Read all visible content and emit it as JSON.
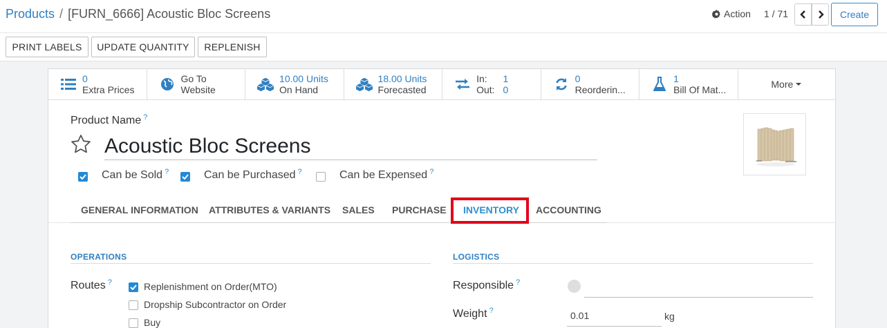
{
  "breadcrumb": {
    "root": "Products",
    "separator": "/",
    "current": "[FURN_6666] Acoustic Bloc Screens"
  },
  "control": {
    "action_label": "Action",
    "pager_value": "1 / 71",
    "create_label": "Create"
  },
  "header_buttons": {
    "print_labels": "PRINT LABELS",
    "update_quantity": "UPDATE QUANTITY",
    "replenish": "REPLENISH"
  },
  "smart_buttons": {
    "extra_prices": {
      "value": "0",
      "label": "Extra Prices",
      "icon": "list-icon"
    },
    "website": {
      "line1": "Go To",
      "line2": "Website",
      "icon": "globe-icon"
    },
    "on_hand": {
      "value": "10.00 Units",
      "label": "On Hand",
      "icon": "cubes-icon"
    },
    "forecasted": {
      "value": "18.00 Units",
      "label": "Forecasted",
      "icon": "cubes-icon"
    },
    "in_out": {
      "in_label": "In:",
      "in_value": "1",
      "out_label": "Out:",
      "out_value": "0",
      "icon": "exchange-icon"
    },
    "reordering": {
      "value": "0",
      "label": "Reorderin...",
      "icon": "refresh-icon"
    },
    "bom": {
      "value": "1",
      "label": "Bill Of Mat...",
      "icon": "flask-icon"
    },
    "more": "More"
  },
  "form": {
    "product_name_label": "Product Name",
    "help_mark": "?",
    "product_name": "Acoustic Bloc Screens",
    "can_be_sold": {
      "label": "Can be Sold",
      "checked": true
    },
    "can_be_purchased": {
      "label": "Can be Purchased",
      "checked": true
    },
    "can_be_expensed": {
      "label": "Can be Expensed",
      "checked": false
    }
  },
  "tabs": [
    {
      "label": "GENERAL INFORMATION",
      "active": false
    },
    {
      "label": "ATTRIBUTES & VARIANTS",
      "active": false
    },
    {
      "label": "SALES",
      "active": false
    },
    {
      "label": "PURCHASE",
      "active": false
    },
    {
      "label": "INVENTORY",
      "active": true
    },
    {
      "label": "ACCOUNTING",
      "active": false
    }
  ],
  "operations": {
    "title": "OPERATIONS",
    "routes_label": "Routes",
    "routes": [
      {
        "label": "Replenishment on Order(MTO)",
        "checked": true
      },
      {
        "label": "Dropship Subcontractor on Order",
        "checked": false
      },
      {
        "label": "Buy",
        "checked": false
      }
    ]
  },
  "logistics": {
    "title": "LOGISTICS",
    "responsible_label": "Responsible",
    "responsible_value": "",
    "weight_label": "Weight",
    "weight_value": "0.01",
    "weight_unit": "kg"
  },
  "colors": {
    "link_blue": "#2f7fc1",
    "checkbox_blue": "#2489d5",
    "highlight_red": "#e2001a"
  }
}
